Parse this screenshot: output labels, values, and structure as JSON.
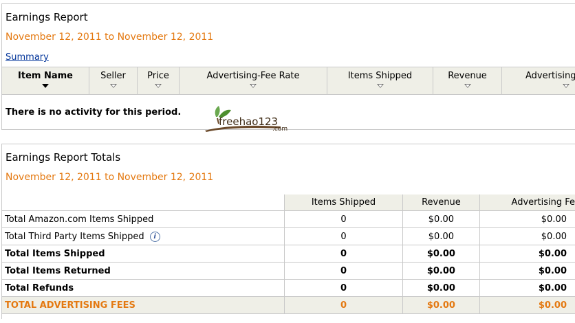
{
  "report": {
    "title": "Earnings Report",
    "range": "November 12, 2011 to November 12, 2011",
    "summary_link": "Summary",
    "columns": [
      "Item Name",
      "Seller",
      "Price",
      "Advertising-Fee Rate",
      "Items Shipped",
      "Revenue",
      "Advertising"
    ],
    "empty_message": "There is no activity for this period."
  },
  "watermark": {
    "text": "freehao123",
    "suffix": ".com"
  },
  "totals": {
    "title": "Earnings Report Totals",
    "range": "November 12, 2011 to November 12, 2011",
    "headers": [
      "Items Shipped",
      "Revenue",
      "Advertising Fe"
    ],
    "rows": [
      {
        "label": "Total Amazon.com Items Shipped",
        "shipped": "0",
        "revenue": "$0.00",
        "fees": "$0.00"
      },
      {
        "label": "Total Third Party Items Shipped",
        "shipped": "0",
        "revenue": "$0.00",
        "fees": "$0.00"
      },
      {
        "label": "Total Items Shipped",
        "shipped": "0",
        "revenue": "$0.00",
        "fees": "$0.00"
      },
      {
        "label": "Total Items Returned",
        "shipped": "0",
        "revenue": "$0.00",
        "fees": "$0.00"
      },
      {
        "label": "Total Refunds",
        "shipped": "0",
        "revenue": "$0.00",
        "fees": "$0.00"
      },
      {
        "label": "TOTAL ADVERTISING FEES",
        "shipped": "0",
        "revenue": "$0.00",
        "fees": "$0.00"
      }
    ],
    "info_icon": "info-icon"
  },
  "colors": {
    "accent": "#e47911",
    "link": "#003399",
    "header_bg": "#efefe7"
  }
}
